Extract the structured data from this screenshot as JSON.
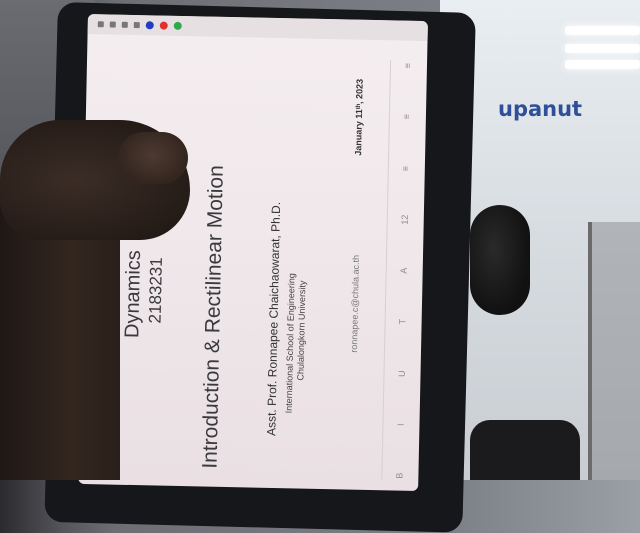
{
  "background": {
    "whiteboard_text": "upanut"
  },
  "slide": {
    "course_name": "Dynamics",
    "course_code": "2183231",
    "title": "Introduction & Rectilinear Motion",
    "presenter": "Asst. Prof. Ronnapee Chaichaowarat, Ph.D.",
    "school": "International School of Engineering",
    "university": "Chulalongkorn University",
    "email": "ronnapee.c@chula.ac.th",
    "date": "January 11ᵗʰ, 2023"
  },
  "toolbar": {
    "colors": [
      "#1f3fbf",
      "#e03030",
      "#2fa84a"
    ],
    "side_icons": [
      "B",
      "I",
      "U",
      "T",
      "A",
      "12",
      "≡",
      "≡",
      "≡"
    ]
  }
}
